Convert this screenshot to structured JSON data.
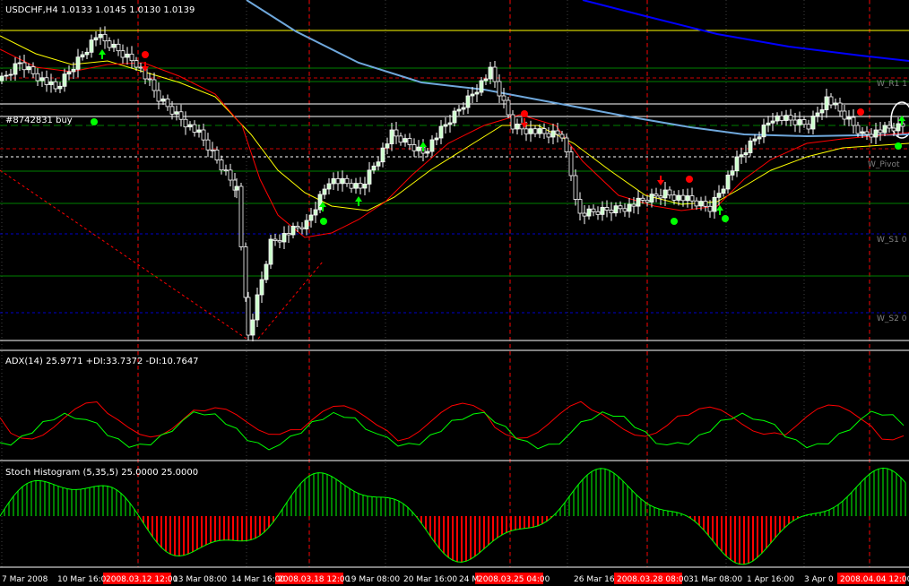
{
  "main": {
    "symbol_line": "USDCHF,H4  1.0133 1.0145 1.0130 1.0139",
    "order_label": "#8742831 buy",
    "pivot_labels": [
      "W_R1 1",
      "W_Pivot",
      "W_S1 0",
      "W_S2 0"
    ]
  },
  "adx": {
    "title": "ADX(14) 25.9771 +DI:33.7372 -DI:10.7647"
  },
  "stoch": {
    "title": "Stoch Histogram (5,35,5) 25.0000 25.0000"
  },
  "time_axis": {
    "labels": [
      "7 Mar 2008",
      "10 Mar 16:0",
      "13 Mar 08:00",
      "14 Mar 16:00",
      "19 Mar 08:00",
      "20 Mar 16:00",
      "24 M",
      "26 Mar 16",
      "31 Mar 08:00",
      "1 Apr 16:00",
      "3 Apr 0"
    ],
    "highlight_labels": [
      "2008.03.12 12:00",
      "2008.03.18 12:00",
      "2008.03.25 04:00",
      "2008.03.28 08:00",
      "2008.04.04 12:00"
    ]
  },
  "colors": {
    "background": "#000000",
    "bull_candle": "#ccffcc",
    "bear_candle": "#000000",
    "wick": "#ffffff",
    "ma_red": "#ff0000",
    "ma_yellow": "#ffff00",
    "ma_lightblue": "#6fa8dc",
    "ma_blue": "#0000ff",
    "pivot_green": "#008000",
    "pivot_blue": "#0000cc",
    "pivot_red": "#cc0000",
    "separator": "#ffffff",
    "hist_up": "#008000",
    "hist_down": "#ff0000",
    "signal_green": "#00ff00",
    "signal_red": "#ff0000",
    "highlight_bg": "#ff0000"
  }
}
